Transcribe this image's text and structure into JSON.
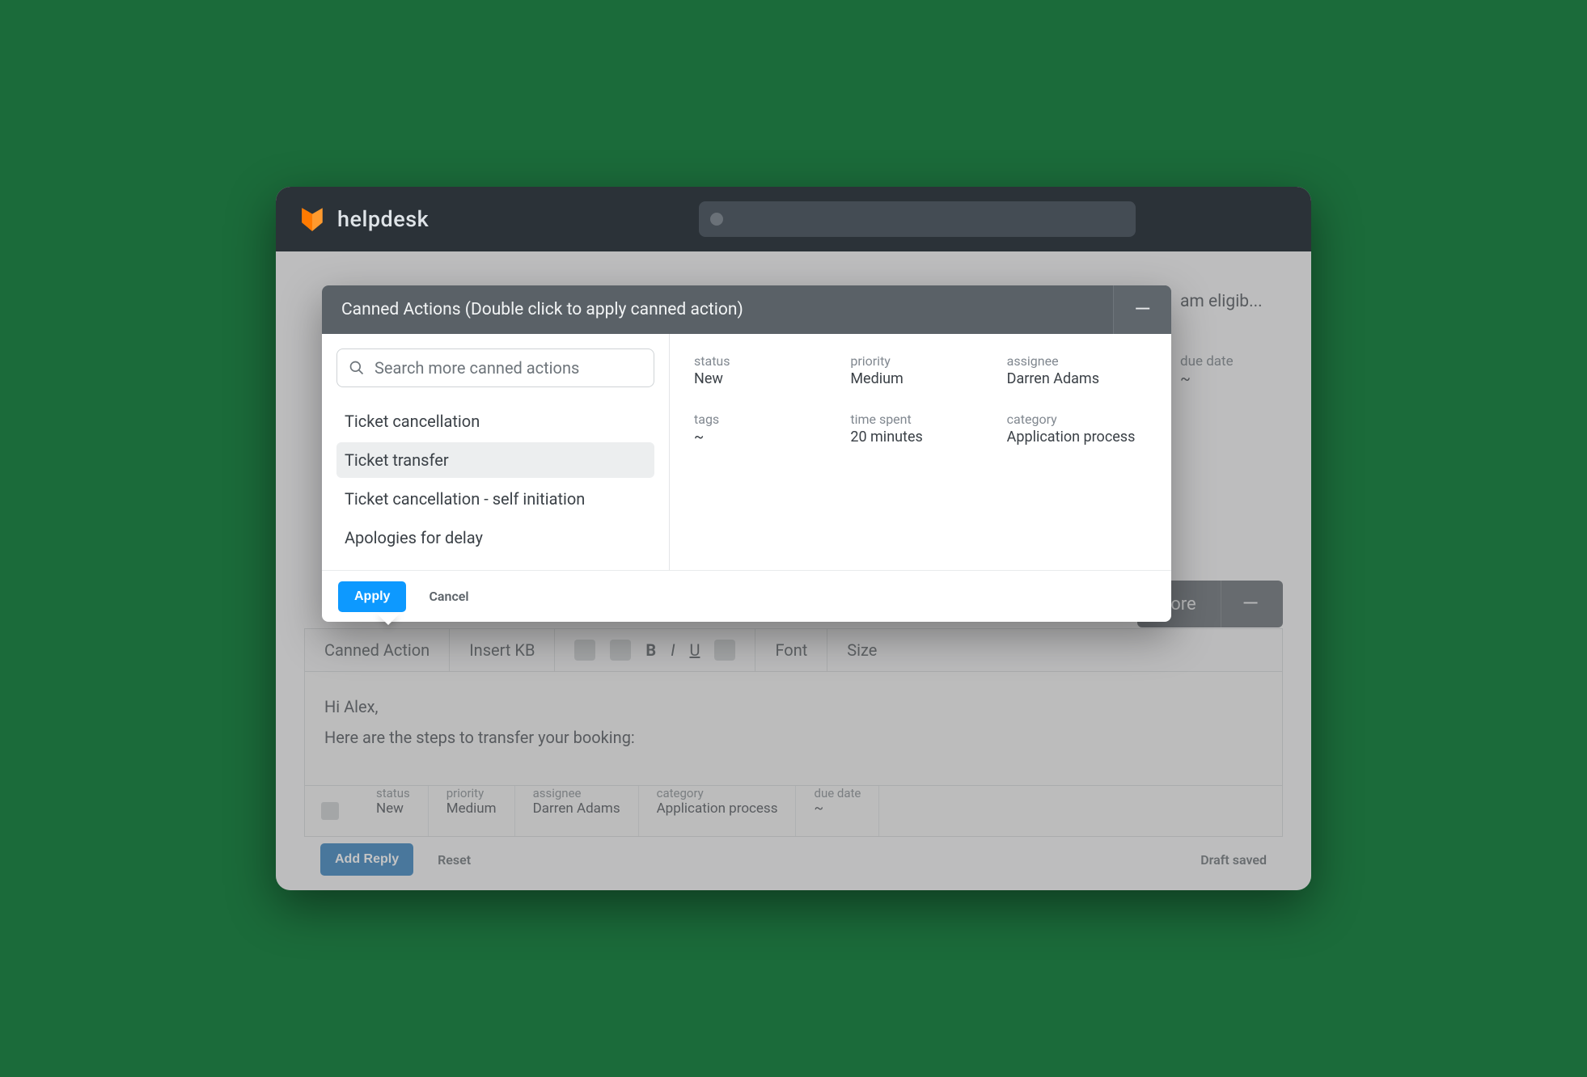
{
  "app": {
    "title": "helpdesk"
  },
  "bg": {
    "title_snippet": "am eligib...",
    "due_label": "due date",
    "due_value": "~",
    "more": "More"
  },
  "toolbar": {
    "canned": "Canned Action",
    "insert_kb": "Insert KB",
    "bold": "B",
    "italic": "I",
    "underline": "U",
    "font": "Font",
    "size": "Size"
  },
  "editor": {
    "line1": "Hi Alex,",
    "line2": "Here are the steps to transfer your booking:"
  },
  "bottom": {
    "cols": [
      {
        "label": "status",
        "value": "New"
      },
      {
        "label": "priority",
        "value": "Medium"
      },
      {
        "label": "assignee",
        "value": "Darren Adams"
      },
      {
        "label": "category",
        "value": "Application process"
      },
      {
        "label": "due date",
        "value": "~"
      }
    ]
  },
  "footer": {
    "add_reply": "Add Reply",
    "reset": "Reset",
    "draft": "Draft saved"
  },
  "modal": {
    "title": "Canned Actions (Double click to apply canned action)",
    "search_placeholder": "Search more canned actions",
    "items": [
      {
        "label": "Ticket cancellation",
        "selected": false
      },
      {
        "label": "Ticket transfer",
        "selected": true
      },
      {
        "label": "Ticket cancellation - self initiation",
        "selected": false
      },
      {
        "label": "Apologies for delay",
        "selected": false
      }
    ],
    "preview": [
      {
        "label": "status",
        "value": "New"
      },
      {
        "label": "priority",
        "value": "Medium"
      },
      {
        "label": "assignee",
        "value": "Darren Adams"
      },
      {
        "label": "tags",
        "value": "~"
      },
      {
        "label": "time spent",
        "value": "20 minutes"
      },
      {
        "label": "category",
        "value": "Application process"
      }
    ],
    "apply": "Apply",
    "cancel": "Cancel"
  }
}
